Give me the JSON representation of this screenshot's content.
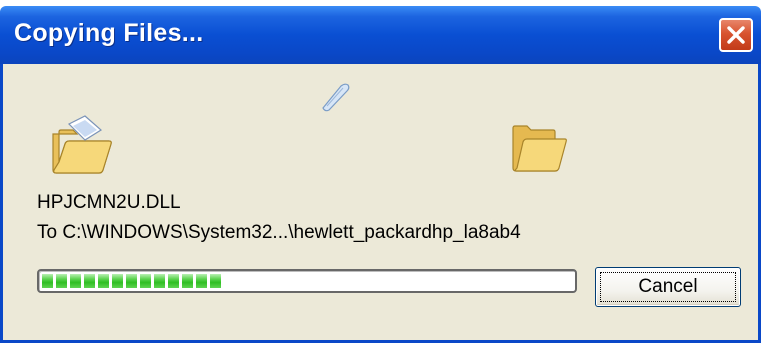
{
  "window": {
    "title": "Copying Files..."
  },
  "title_bar_buttons": {
    "close_icon": "close-icon"
  },
  "file": {
    "name": "HPJCMN2U.DLL",
    "destination": "To C:\\WINDOWS\\System32...\\hewlett_packardhp_la8ab4"
  },
  "progress": {
    "fraction": 0.37,
    "segments_filled": 13,
    "color": "#2fbe23"
  },
  "buttons": {
    "cancel_label": "Cancel"
  },
  "icons": {
    "source": "source-folder-icon",
    "destination": "destination-folder-icon",
    "flying": "flying-document-icon"
  },
  "colors": {
    "titlebar": "#0a4fd3",
    "client_bg": "#ece9d8",
    "close_button": "#d8532f"
  }
}
